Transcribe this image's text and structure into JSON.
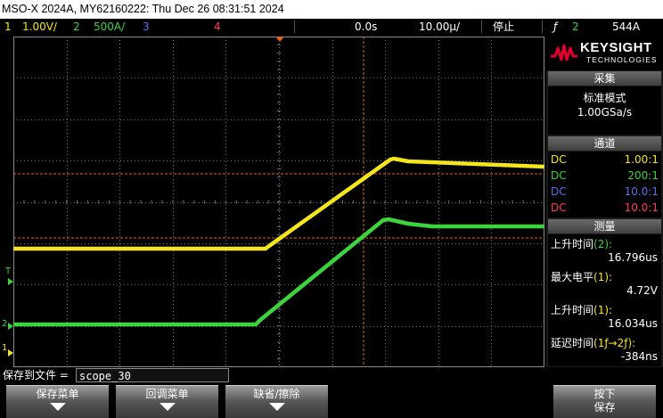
{
  "title": "MSO-X 2024A, MY62160222: Thu Dec 26 08:31:51 2024",
  "status": {
    "ch1_num": "1",
    "ch1_scale": "1.00V/",
    "ch2_num": "2",
    "ch2_scale": "500A/",
    "ch3_num": "3",
    "ch4_num": "4",
    "time_offset": "0.0s",
    "time_scale": "10.00µ/",
    "run_state": "停止",
    "trigger_icon": "ƒ",
    "trigger_channel": "2",
    "trigger_level": "544A"
  },
  "colors": {
    "ch1": "#f5e61c",
    "ch2": "#3cd43c",
    "ch3": "#5b6ff0",
    "ch4": "#ff3b5c",
    "cursor": "#e0641e",
    "grid": "#6e6e6e"
  },
  "panel": {
    "logo_brand": "KEYSIGHT",
    "logo_sub": "TECHNOLOGIES",
    "acq_header": "采集",
    "acq_mode": "标准模式",
    "acq_rate": "1.00GSa/s",
    "chan_header": "通道",
    "channels": [
      {
        "coupling": "DC",
        "ratio": "1.00:1"
      },
      {
        "coupling": "DC",
        "ratio": "200:1"
      },
      {
        "coupling": "DC",
        "ratio": "10.0:1"
      },
      {
        "coupling": "DC",
        "ratio": "10.0:1"
      }
    ],
    "meas_header": "测量",
    "measurements": [
      {
        "name": "上升时间",
        "ch": "(2):",
        "value": "16.796us"
      },
      {
        "name": "最大电平",
        "ch": "(1):",
        "value": "4.72V"
      },
      {
        "name": "上升时间",
        "ch": "(1):",
        "value": "16.034us"
      },
      {
        "name": "延迟时间",
        "ch": "(1ƒ→2ƒ):",
        "value": "-384ns"
      }
    ]
  },
  "save": {
    "label": "保存到文件 =",
    "filename": "scope_30"
  },
  "softkeys": [
    {
      "label": "保存菜单"
    },
    {
      "label": "回调菜单"
    },
    {
      "label": "缺省/擦除"
    },
    {
      "label": "按下",
      "label2": "保存"
    }
  ],
  "markers": {
    "ch1_ground": "1",
    "ch2_ground": "2",
    "trigger_level": "T"
  }
}
